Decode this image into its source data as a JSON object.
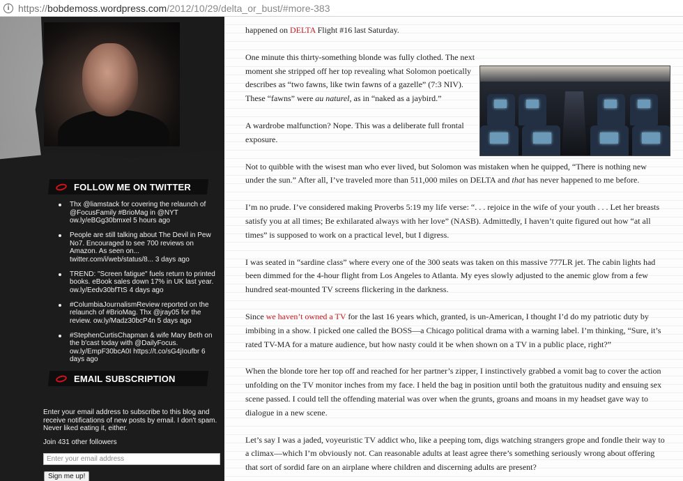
{
  "browser": {
    "url_scheme": "https://",
    "url_domain": "bobdemoss.wordpress.com",
    "url_path": "/2012/10/29/delta_or_bust/#more-383"
  },
  "sidebar": {
    "twitter_title": "FOLLOW ME ON TWITTER",
    "tweets": [
      {
        "text": "Thx @liamstack for covering the relaunch of @FocusFamily #BrioMag in @NYT ow.ly/eBGg30bmxel",
        "ago": "5 hours ago"
      },
      {
        "text": "People are still talking about The Devil in Pew No7. Encouraged to see 700 reviews on Amazon. As seen on... twitter.com/i/web/status/8...",
        "ago": "3 days ago"
      },
      {
        "text": "TREND: \"Screen fatigue\" fuels return to printed books. eBook sales down 17% in UK last year. ow.ly/Eedv30bfTtS",
        "ago": "4 days ago"
      },
      {
        "text": "#ColumbiaJournalismReview reported on the relaunch of #BrioMag. Thx @jray05 for the review. ow.ly/Madz30bcP4n",
        "ago": "5 days ago"
      },
      {
        "text": "#StephenCurtisChapman & wife Mary Beth on the b'cast today with @DailyFocus. ow.ly/EmpF30bcA0I https://t.co/sG4jIoufbr",
        "ago": "6 days ago"
      }
    ],
    "email_title": "EMAIL SUBSCRIPTION",
    "email_text": "Enter your email address to subscribe to this blog and receive notifications of new posts by email. I don't spam. Never liked eating it, either.",
    "followers": "Join 431 other followers",
    "email_placeholder": "Enter your email address",
    "signup_label": "Sign me up!"
  },
  "post": {
    "p1_a": "happened on ",
    "p1_link": "DELTA",
    "p1_b": " Flight #16 last Saturday.",
    "p2_a": "One minute this thirty-something blonde was fully clothed. The next moment she stripped off her top revealing what Solomon poetically describes as “two fawns, like twin fawns of a gazelle” (7:3 NIV). These “fawns” were ",
    "p2_em": "au naturel",
    "p2_b": ", as in “naked as a jaybird.”",
    "p3": "A wardrobe malfunction? Nope. This was a deliberate full frontal exposure.",
    "p4_a": "Not to quibble with the wisest man who ever lived, but Solomon was mistaken when he quipped, “There is nothing new under the sun.” After all, I’ve traveled more than 511,000 miles on DELTA and ",
    "p4_em": "that",
    "p4_b": " has never happened to me before.",
    "p5": "I’m no prude. I’ve considered making Proverbs 5:19 my life verse: “. . . rejoice in the wife of your youth . . . Let her breasts satisfy you at all times; Be exhilarated always with her love” (NASB). Admittedly, I haven’t quite figured out how “at all times” is supposed to work on a practical level, but I digress.",
    "p6": "I was seated in “sardine class” where every one of the 300 seats was taken on this massive 777LR jet. The cabin lights had been dimmed for the 4-hour flight from Los Angeles to Atlanta. My eyes slowly adjusted to the anemic glow from a few hundred seat-mounted TV screens flickering in the darkness.",
    "p7_a": "Since ",
    "p7_link": "we haven’t owned a TV",
    "p7_b": " for the last 16 years which, granted, is un-American, I thought I’d do my patriotic duty by imbibing in a show. I picked one called the BOSS—a Chicago political drama with a warning label. I’m thinking, “Sure, it’s rated TV-MA for a mature audience, but how nasty could it be when shown on a TV in a public place, right?”",
    "p8": "When the blonde tore her top off and reached for her partner’s zipper, I instinctively grabbed a vomit bag to cover the action unfolding on the TV monitor inches from my face. I held the bag in position until both the gratuitous nudity and ensuing sex scene passed. I could tell the offending material was over when the grunts, groans and moans in my headset gave way to dialogue in a new scene.",
    "p9": "Let’s say I was a jaded, voyeuristic TV addict who, like a peeping tom, digs watching strangers grope and fondle their way to a climax—which I’m obviously not. Can reasonable adults at least agree there’s something seriously wrong about offering that sort of sordid fare on an airplane where children and discerning adults are present?"
  }
}
